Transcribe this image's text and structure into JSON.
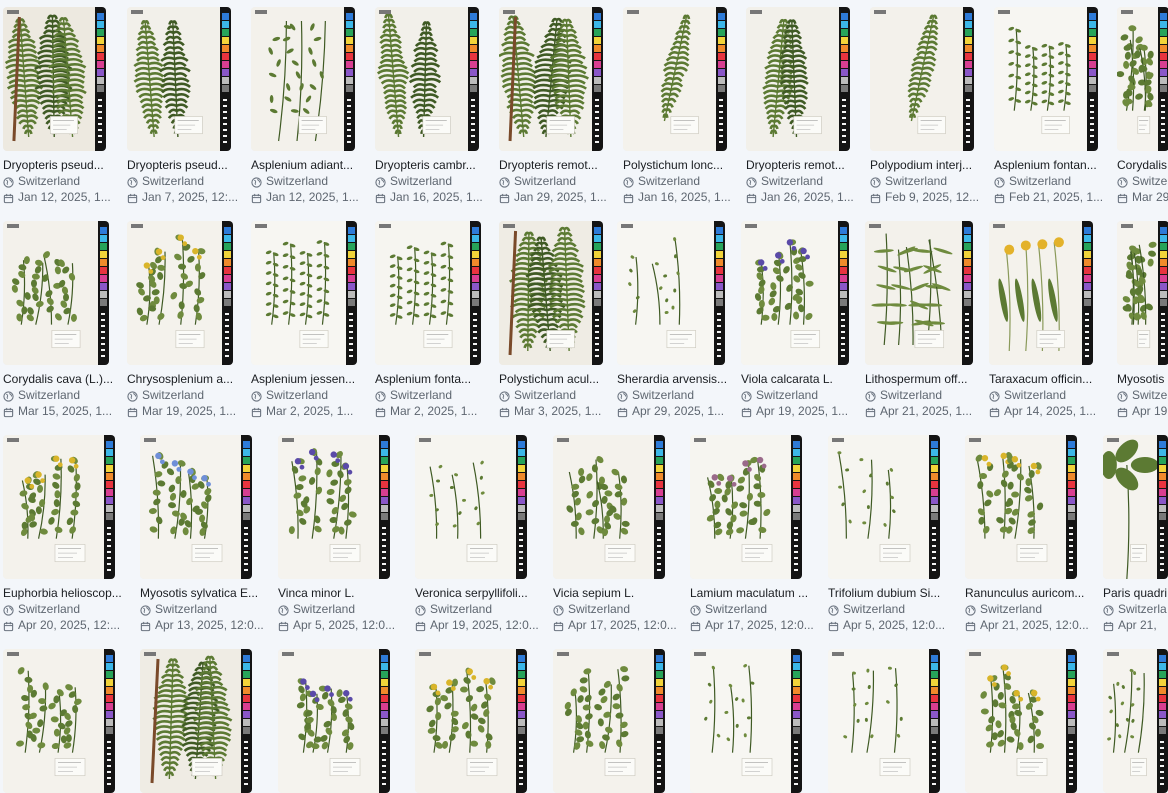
{
  "rows": [
    {
      "items": [
        {
          "name": "Dryopteris pseud...",
          "place": "Switzerland",
          "date": "Jan 12, 2025, 1...",
          "kind": "fern-dense",
          "paper": "#ede9e0"
        },
        {
          "name": "Dryopteris pseud...",
          "place": "Switzerland",
          "date": "Jan 7, 2025, 12:...",
          "kind": "fern",
          "paper": "#f2f0ea"
        },
        {
          "name": "Asplenium adiant...",
          "place": "Switzerland",
          "date": "Jan 12, 2025, 1...",
          "kind": "fern-lace",
          "paper": "#f3f1eb"
        },
        {
          "name": "Dryopteris cambr...",
          "place": "Switzerland",
          "date": "Jan 16, 2025, 1...",
          "kind": "fern",
          "paper": "#f2f0ea"
        },
        {
          "name": "Dryopteris remot...",
          "place": "Switzerland",
          "date": "Jan 29, 2025, 1...",
          "kind": "fern-dense",
          "paper": "#f2f0ea"
        },
        {
          "name": "Polystichum lonc...",
          "place": "Switzerland",
          "date": "Jan 16, 2025, 1...",
          "kind": "fern-single",
          "paper": "#f4f2ec"
        },
        {
          "name": "Dryopteris remot...",
          "place": "Switzerland",
          "date": "Jan 26, 2025, 1...",
          "kind": "fern",
          "paper": "#f2f0ea"
        },
        {
          "name": "Polypodium interj...",
          "place": "Switzerland",
          "date": "Feb 9, 2025, 12...",
          "kind": "fern-single",
          "paper": "#f3f1eb"
        },
        {
          "name": "Asplenium fontan...",
          "place": "Switzerland",
          "date": "Feb 21, 2025, 1...",
          "kind": "sprigs",
          "paper": "#f7f6f2"
        },
        {
          "name": "Corydalis",
          "place": "Switzer",
          "date": "Mar 29",
          "kind": "herb",
          "paper": "#f5f3ee"
        }
      ]
    },
    {
      "items": [
        {
          "name": "Corydalis cava (L.)...",
          "place": "Switzerland",
          "date": "Mar 15, 2025, 1...",
          "kind": "herb",
          "paper": "#f3f1eb"
        },
        {
          "name": "Chrysosplenium a...",
          "place": "Switzerland",
          "date": "Mar 19, 2025, 1...",
          "kind": "herb-yellow",
          "paper": "#f4f2ec"
        },
        {
          "name": "Asplenium jessen...",
          "place": "Switzerland",
          "date": "Mar 2, 2025, 1...",
          "kind": "sprigs",
          "paper": "#f7f6f2"
        },
        {
          "name": "Asplenium fonta...",
          "place": "Switzerland",
          "date": "Mar 2, 2025, 1...",
          "kind": "sprigs",
          "paper": "#f6f5f0"
        },
        {
          "name": "Polystichum acul...",
          "place": "Switzerland",
          "date": "Mar 3, 2025, 1...",
          "kind": "fern-dense",
          "paper": "#efece4"
        },
        {
          "name": "Sherardia arvensis...",
          "place": "Switzerland",
          "date": "Apr 29, 2025, 1...",
          "kind": "tiny",
          "paper": "#f7f6f2"
        },
        {
          "name": "Viola calcarata L.",
          "place": "Switzerland",
          "date": "Apr 19, 2025, 1...",
          "kind": "herb-purple",
          "paper": "#f6f5f0"
        },
        {
          "name": "Lithospermum off...",
          "place": "Switzerland",
          "date": "Apr 21, 2025, 1...",
          "kind": "grassy",
          "paper": "#f3f1eb"
        },
        {
          "name": "Taraxacum officin...",
          "place": "Switzerland",
          "date": "Apr 14, 2025, 1...",
          "kind": "dandelion",
          "paper": "#f4f2ec"
        },
        {
          "name": "Myosotis",
          "place": "Switzer",
          "date": "Apr 19",
          "kind": "herb",
          "paper": "#f5f3ee"
        }
      ]
    },
    {
      "items": [
        {
          "name": "Euphorbia helioscop...",
          "place": "Switzerland",
          "date": "Apr 20, 2025, 12:...",
          "kind": "herb-yellow",
          "paper": "#f4f2ec"
        },
        {
          "name": "Myosotis sylvatica E...",
          "place": "Switzerland",
          "date": "Apr 13, 2025, 12:0...",
          "kind": "herb-blue",
          "paper": "#f5f3ee"
        },
        {
          "name": "Vinca minor L.",
          "place": "Switzerland",
          "date": "Apr 5, 2025, 12:0...",
          "kind": "herb-purple",
          "paper": "#f5f3ee"
        },
        {
          "name": "Veronica serpyllifoli...",
          "place": "Switzerland",
          "date": "Apr 19, 2025, 12:0...",
          "kind": "tiny",
          "paper": "#f6f5f0"
        },
        {
          "name": "Vicia sepium L.",
          "place": "Switzerland",
          "date": "Apr 17, 2025, 12:0...",
          "kind": "herb",
          "paper": "#f4f2ec"
        },
        {
          "name": "Lamium maculatum ...",
          "place": "Switzerland",
          "date": "Apr 17, 2025, 12:0...",
          "kind": "herb-pink",
          "paper": "#f6f5f0"
        },
        {
          "name": "Trifolium dubium Si...",
          "place": "Switzerland",
          "date": "Apr 5, 2025, 12:0...",
          "kind": "tiny",
          "paper": "#f6f5f0"
        },
        {
          "name": "Ranunculus auricom...",
          "place": "Switzerland",
          "date": "Apr 21, 2025, 12:0...",
          "kind": "herb-yellow",
          "paper": "#f5f3ee"
        },
        {
          "name": "Paris quadri",
          "place": "Switzerla",
          "date": "Apr 21,",
          "kind": "paris",
          "paper": "#f5f3ee"
        }
      ]
    },
    {
      "items": [
        {
          "name": "",
          "place": "",
          "date": "",
          "kind": "herb",
          "paper": "#f4f2ec"
        },
        {
          "name": "",
          "place": "",
          "date": "",
          "kind": "fern-dense",
          "paper": "#efece4"
        },
        {
          "name": "",
          "place": "",
          "date": "",
          "kind": "herb-purple",
          "paper": "#f5f3ee"
        },
        {
          "name": "",
          "place": "",
          "date": "",
          "kind": "herb-yellow",
          "paper": "#f4f2ec"
        },
        {
          "name": "",
          "place": "",
          "date": "",
          "kind": "herb",
          "paper": "#f4f2ec"
        },
        {
          "name": "",
          "place": "",
          "date": "",
          "kind": "tiny",
          "paper": "#f7f6f2"
        },
        {
          "name": "",
          "place": "",
          "date": "",
          "kind": "tiny",
          "paper": "#f7f6f2"
        },
        {
          "name": "",
          "place": "",
          "date": "",
          "kind": "herb-yellow",
          "paper": "#f5f3ee"
        },
        {
          "name": "",
          "place": "",
          "date": "",
          "kind": "tiny",
          "paper": "#f5f3ee"
        }
      ]
    }
  ],
  "icons": {
    "place": "globe-icon",
    "date": "calendar-icon"
  },
  "colors": {
    "background": "#f3f6fa",
    "text": "#1a1d21",
    "meta": "#5e6670",
    "colorbar": "#141414"
  }
}
